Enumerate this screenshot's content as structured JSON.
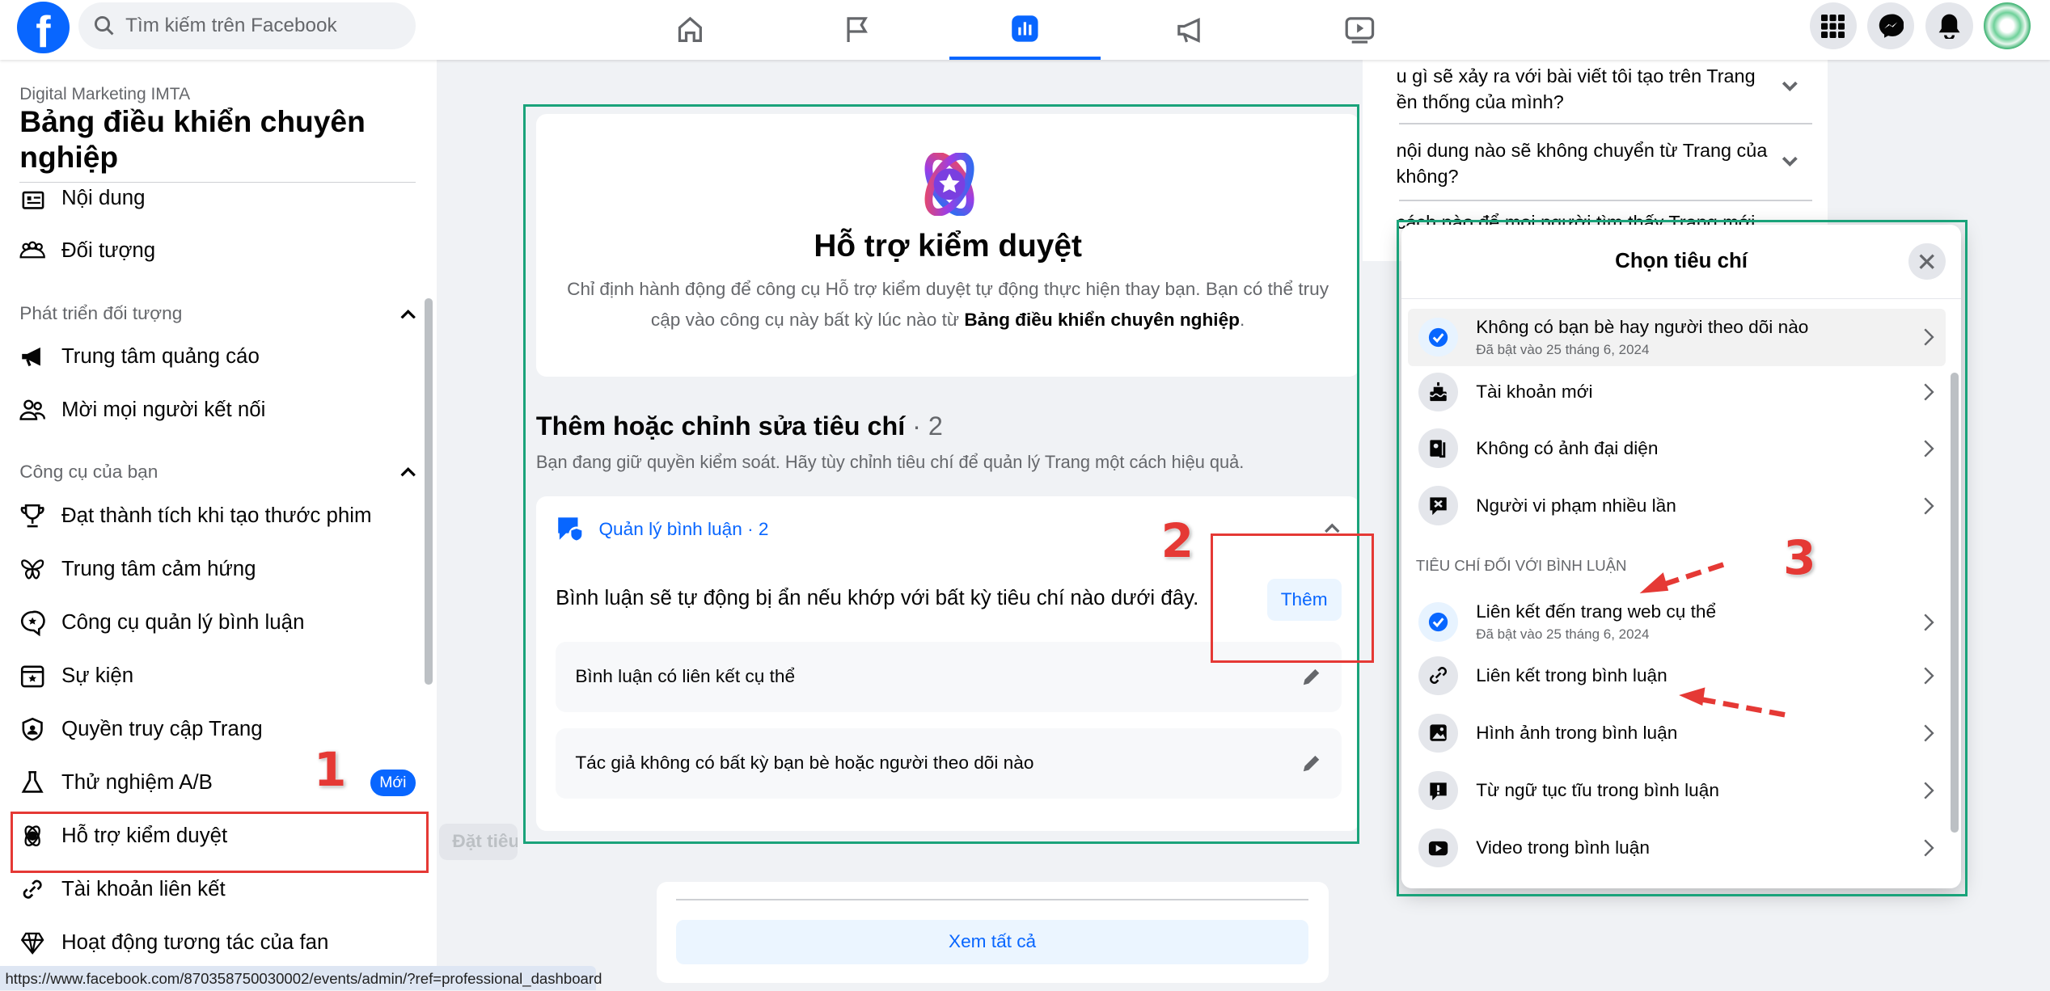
{
  "header": {
    "search_placeholder": "Tìm kiếm trên Facebook",
    "nav": [
      "home-icon",
      "flag-icon",
      "dashboard-icon",
      "megaphone-icon",
      "video-icon"
    ],
    "active_nav": "dashboard-icon",
    "right": [
      "menu-grid-icon",
      "messenger-icon",
      "bell-icon",
      "avatar"
    ]
  },
  "sidebar": {
    "page_name": "Digital Marketing IMTA",
    "title": "Bảng điều khiển chuyên nghiệp",
    "items_top": [
      {
        "label": "Nội dung",
        "icon": "content-icon"
      },
      {
        "label": "Đối tượng",
        "icon": "audience-icon"
      }
    ],
    "section1": "Phát triển đối tượng",
    "items_s1": [
      {
        "label": "Trung tâm quảng cáo",
        "icon": "megaphone-icon"
      },
      {
        "label": "Mời mọi người kết nối",
        "icon": "people-icon"
      }
    ],
    "section2": "Công cụ của bạn",
    "items_s2": [
      {
        "label": "Đạt thành tích khi tạo thước phim",
        "icon": "trophy-icon"
      },
      {
        "label": "Trung tâm cảm hứng",
        "icon": "butterfly-icon"
      },
      {
        "label": "Công cụ quản lý bình luận",
        "icon": "comment-icon"
      },
      {
        "label": "Sự kiện",
        "icon": "calendar-icon"
      },
      {
        "label": "Quyền truy cập Trang",
        "icon": "shield-icon"
      },
      {
        "label": "Thử nghiệm A/B",
        "icon": "flask-icon",
        "badge": "Mới"
      },
      {
        "label": "Hỗ trợ kiểm duyệt",
        "icon": "moderation-icon",
        "selected": true
      },
      {
        "label": "Tài khoản liên kết",
        "icon": "link-icon"
      },
      {
        "label": "Hoạt động tương tác của fan",
        "icon": "diamond-icon"
      }
    ]
  },
  "main": {
    "ghost_button": "Đặt tiêu",
    "hero": {
      "title": "Hỗ trợ kiểm duyệt",
      "desc_1": "Chỉ định hành động để công cụ Hỗ trợ kiểm duyệt tự động thực hiện thay bạn. Bạn có thể truy",
      "desc_2": "cập vào công cụ này bất kỳ lúc nào từ ",
      "desc_link": "Bảng điều khiển chuyên nghiệp",
      "desc_end": "."
    },
    "section_title": "Thêm hoặc chỉnh sửa tiêu chí",
    "section_count": " · 2",
    "section_sub": "Bạn đang giữ quyền kiểm soát. Hãy tùy chỉnh tiêu chí để quản lý Trang một cách hiệu quả.",
    "comment_card": {
      "title": "Quản lý bình luận · 2",
      "desc": "Bình luận sẽ tự động bị ẩn nếu khớp với bất kỳ tiêu chí nào dưới đây.",
      "add_button": "Thêm",
      "rows": [
        "Bình luận có liên kết cụ thể",
        "Tác giả không có bất kỳ bạn bè hoặc người theo dõi nào"
      ]
    },
    "see_all": "Xem tất cả"
  },
  "faq": [
    {
      "l1": "u gì sẽ xảy ra với bài viết tôi tạo trên Trang",
      "l2": "ền thống của mình?"
    },
    {
      "l1": "nội dung nào sẽ không chuyển từ Trang của",
      "l2": "không?"
    },
    {
      "l1": "cách nào để mọi người tìm thấy Trang mới",
      "l2": ""
    }
  ],
  "dialog": {
    "title": "Chọn tiêu chí",
    "items": [
      {
        "label": "Không có bạn bè hay người theo dõi nào",
        "sub": "Đã bật vào 25 tháng 6, 2024",
        "icon": "check-circle-icon",
        "checked": true
      },
      {
        "label": "Tài khoản mới",
        "icon": "cake-icon"
      },
      {
        "label": "Không có ảnh đại diện",
        "icon": "no-photo-icon"
      },
      {
        "label": "Người vi phạm nhiều lần",
        "icon": "violation-icon"
      }
    ],
    "section": "TIÊU CHÍ ĐỐI VỚI BÌNH LUẬN",
    "comment_items": [
      {
        "label": "Liên kết đến trang web cụ thể",
        "sub": "Đã bật vào 25 tháng 6, 2024",
        "icon": "check-circle-icon",
        "checked": true
      },
      {
        "label": "Liên kết trong bình luận",
        "icon": "link-icon"
      },
      {
        "label": "Hình ảnh trong bình luận",
        "icon": "image-icon"
      },
      {
        "label": "Từ ngữ tục tĩu trong bình luận",
        "icon": "profanity-icon"
      },
      {
        "label": "Video trong bình luận",
        "icon": "video-icon"
      }
    ]
  },
  "annotations": {
    "n1": "1",
    "n2": "2",
    "n3": "3"
  },
  "status_url": "https://www.facebook.com/870358750030002/events/admin/?ref=professional_dashboard",
  "colors": {
    "brand": "#0866ff",
    "annotation_red": "#e53935",
    "highlight_green": "#1aa37a"
  }
}
